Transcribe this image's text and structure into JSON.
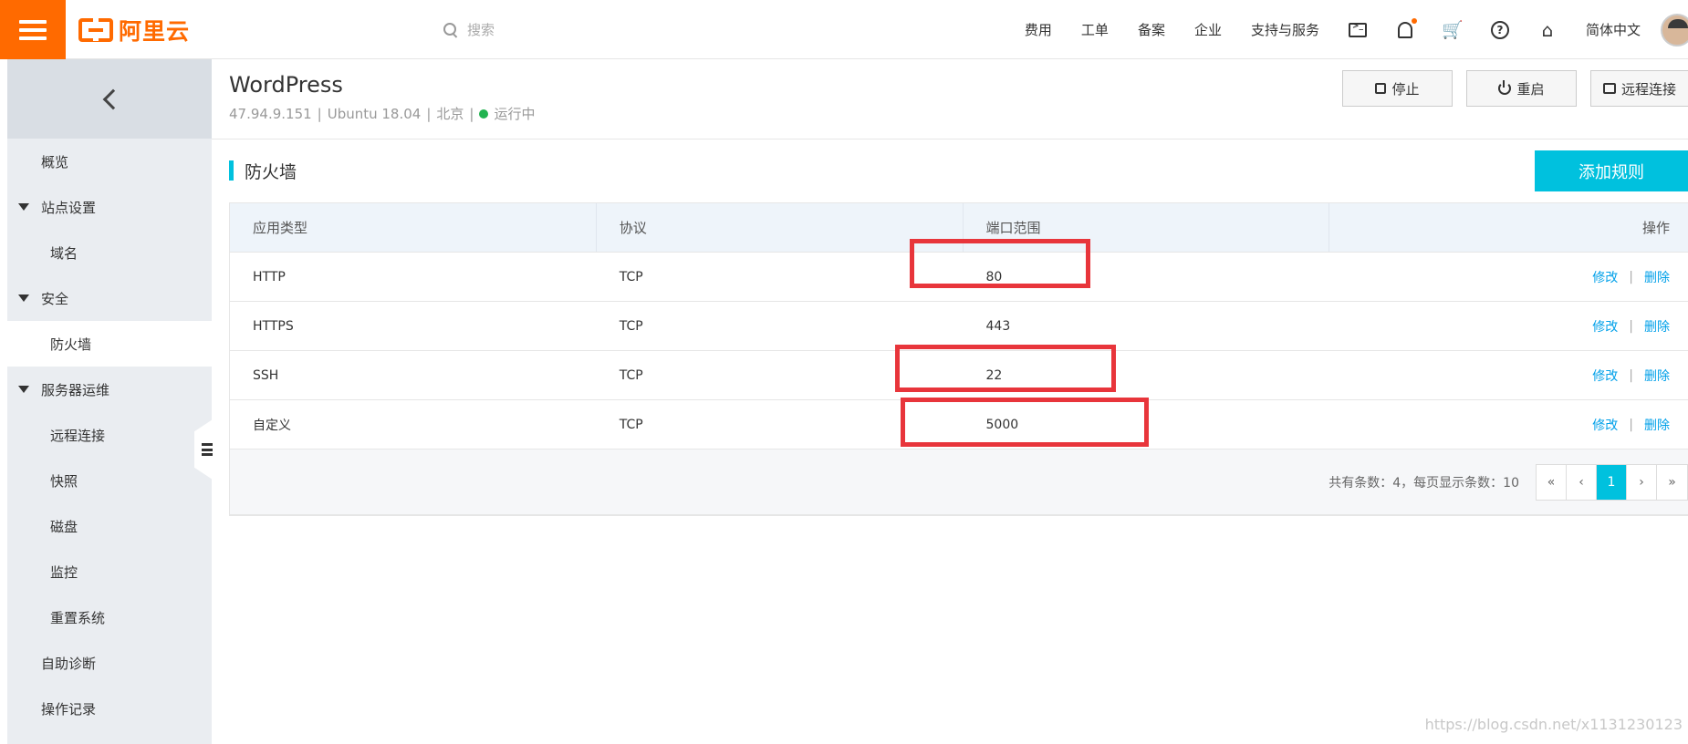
{
  "topbar": {
    "brand": "阿里云",
    "search_placeholder": "搜索",
    "nav": [
      "费用",
      "工单",
      "备案",
      "企业",
      "支持与服务"
    ],
    "language": "简体中文",
    "icons": [
      "terminal-icon",
      "bell-icon",
      "cart-icon",
      "help-icon",
      "home-icon"
    ],
    "accent_color": "#ff6a00"
  },
  "sidebar": {
    "items": [
      {
        "label": "概览",
        "type": "item"
      },
      {
        "label": "站点设置",
        "type": "group"
      },
      {
        "label": "域名",
        "type": "sub"
      },
      {
        "label": "安全",
        "type": "group"
      },
      {
        "label": "防火墙",
        "type": "sub",
        "active": true
      },
      {
        "label": "服务器运维",
        "type": "group"
      },
      {
        "label": "远程连接",
        "type": "sub"
      },
      {
        "label": "快照",
        "type": "sub"
      },
      {
        "label": "磁盘",
        "type": "sub"
      },
      {
        "label": "监控",
        "type": "sub"
      },
      {
        "label": "重置系统",
        "type": "sub"
      },
      {
        "label": "自助诊断",
        "type": "item"
      },
      {
        "label": "操作记录",
        "type": "item"
      }
    ]
  },
  "header": {
    "title": "WordPress",
    "ip": "47.94.9.151",
    "os": "Ubuntu 18.04",
    "region": "北京",
    "status": "运行中",
    "sep": "|",
    "buttons": {
      "stop": "停止",
      "restart": "重启",
      "remote": "远程连接"
    }
  },
  "firewall": {
    "title": "防火墙",
    "add_button": "添加规则",
    "columns": [
      "应用类型",
      "协议",
      "端口范围",
      "操作"
    ],
    "rows": [
      {
        "type": "HTTP",
        "protocol": "TCP",
        "port": "80"
      },
      {
        "type": "HTTPS",
        "protocol": "TCP",
        "port": "443"
      },
      {
        "type": "SSH",
        "protocol": "TCP",
        "port": "22"
      },
      {
        "type": "自定义",
        "protocol": "TCP",
        "port": "5000"
      }
    ],
    "actions": {
      "edit": "修改",
      "sep": "|",
      "delete": "删除"
    },
    "pager": {
      "info": "共有条数：4，每页显示条数：10",
      "first": "«",
      "prev": "‹",
      "current": "1",
      "next": "›",
      "last": "»"
    },
    "accent_color": "#00c1de",
    "link_color": "#00a0e9",
    "highlight_color": "#e8353b"
  },
  "watermark": "https://blog.csdn.net/x1131230123"
}
